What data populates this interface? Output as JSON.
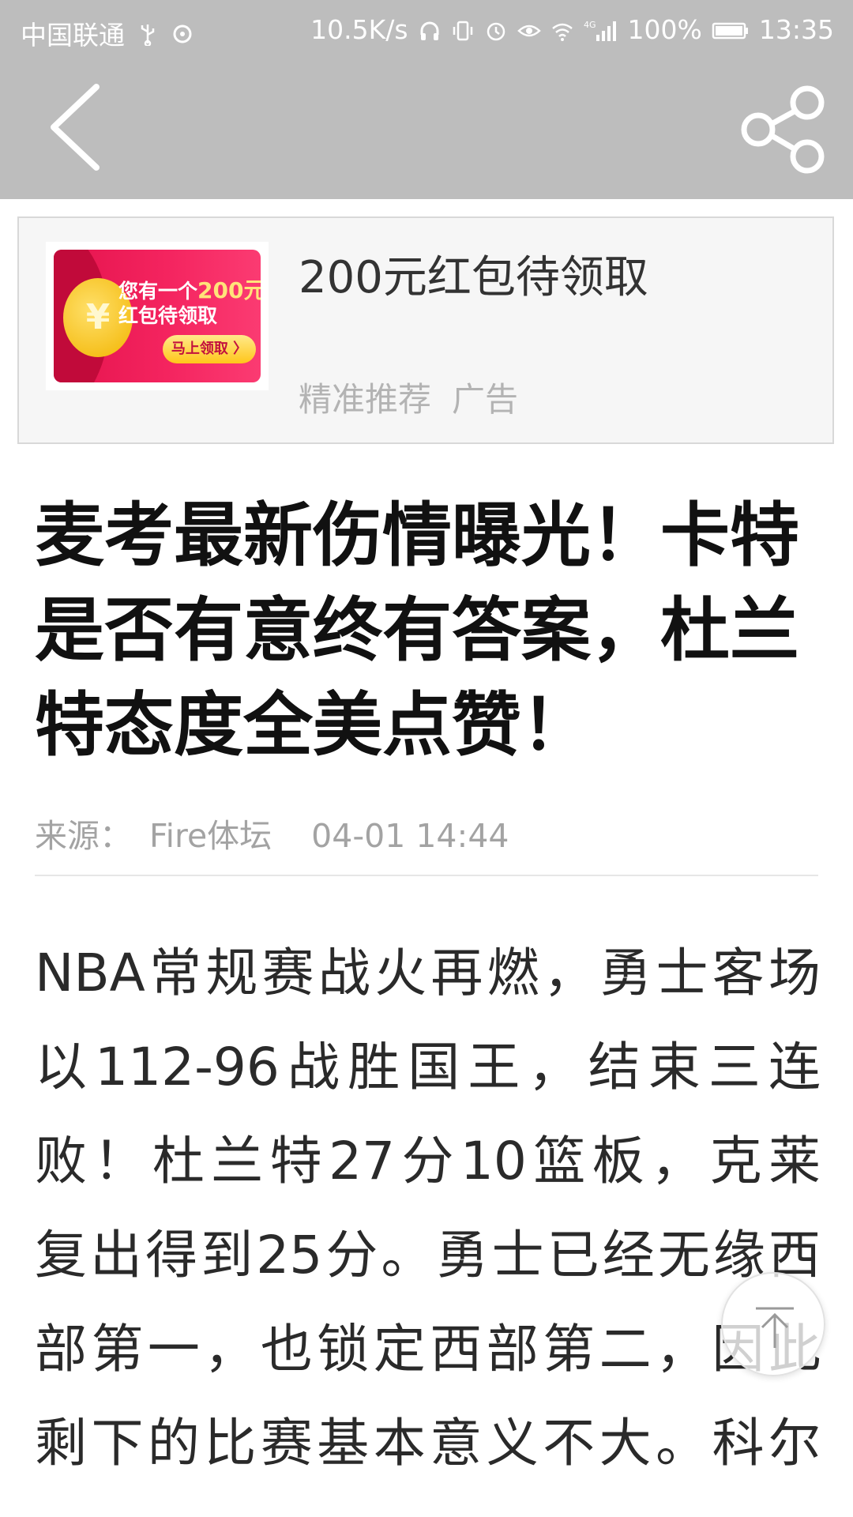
{
  "status_bar": {
    "carrier": "中国联通",
    "net_speed": "10.5K/s",
    "signal_label": "4G",
    "battery": "100%",
    "time": "13:35"
  },
  "header": {
    "back_icon": "chevron-left-icon",
    "share_icon": "share-icon"
  },
  "ad": {
    "image_text_line1_prefix": "您有一个",
    "image_text_amount": "200元",
    "image_text_line2": "红包待领取",
    "image_button": "马上领取 〉",
    "title": "200元红包待领取",
    "tag1": "精准推荐",
    "tag2": "广告"
  },
  "article": {
    "headline": "麦考最新伤情曝光！卡特是否有意终有答案，杜兰特态度全美点赞！",
    "source_label": "来源：",
    "source_name": "Fire体坛",
    "date": "04-01 14:44",
    "body_lines": [
      "NBA常规赛战火再燃，勇士客场",
      "以112-96战胜国王，结束三连",
      "败！杜兰特27分10篮板，克莱",
      "复出得到25分。勇士已经无缘西",
      "部第一，也锁定西部第二，因此",
      "剩下的比赛基本意义不大。科尔"
    ]
  },
  "back_to_top": {
    "icon": "arrow-up-icon"
  },
  "colors": {
    "header_bg": "#bdbdbd",
    "ad_red": "#f4245f",
    "meta_gray": "#a3a3a3"
  }
}
